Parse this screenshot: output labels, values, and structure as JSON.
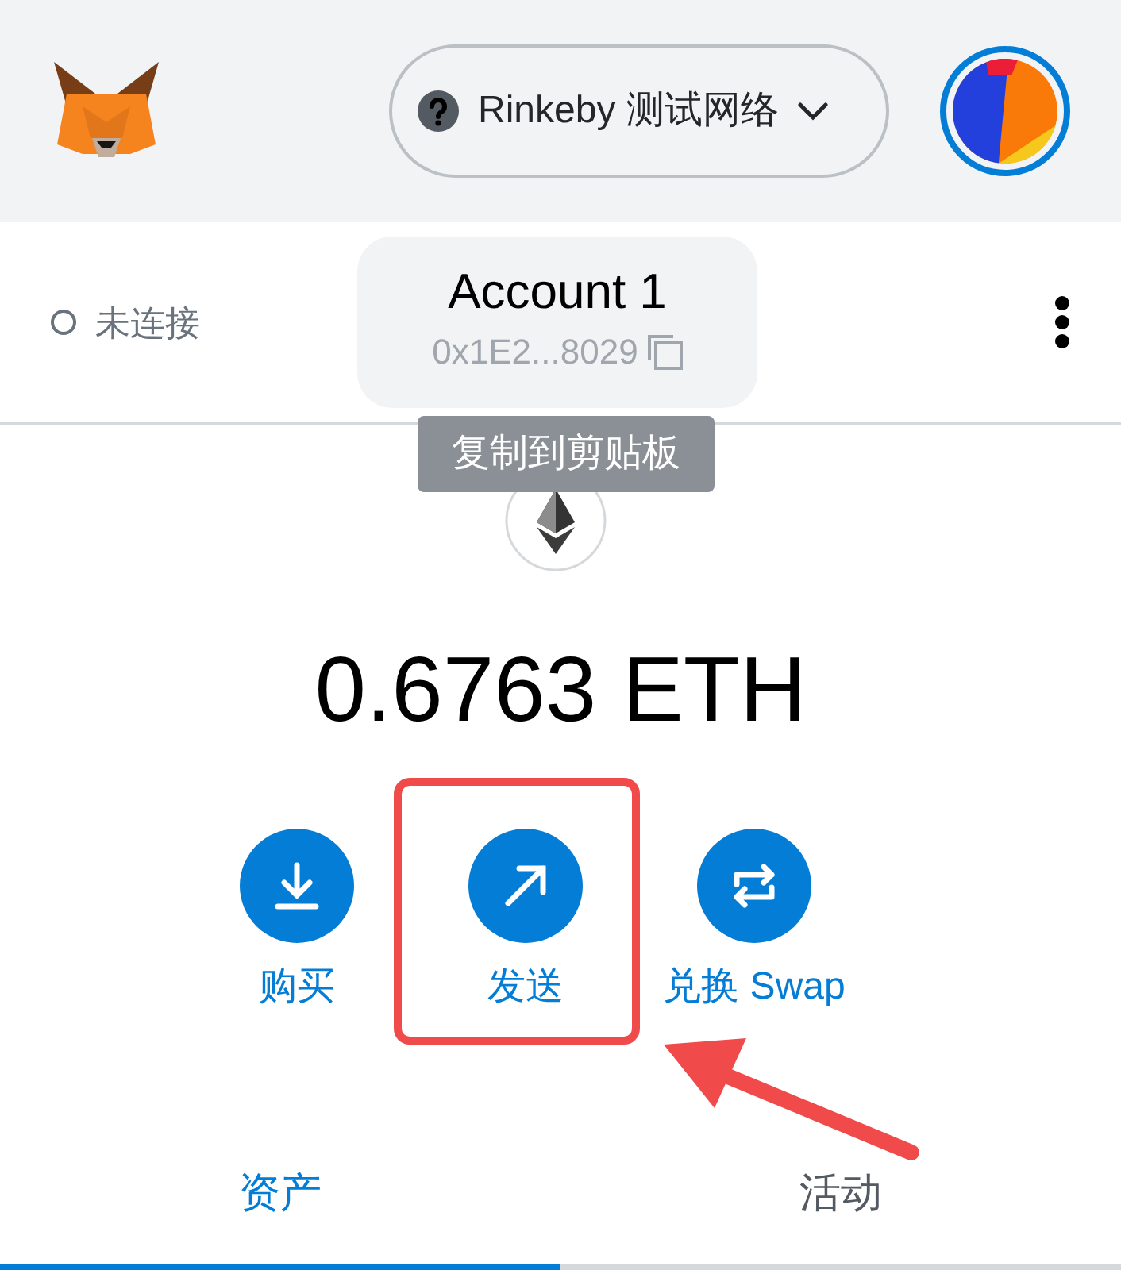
{
  "header": {
    "network": {
      "label": "Rinkeby 测试网络"
    }
  },
  "account": {
    "status": "未连接",
    "connected": false,
    "name": "Account 1",
    "address": "0x1E2...8029",
    "tooltip": "复制到剪贴板"
  },
  "balance": "0.6763 ETH",
  "actions": [
    {
      "kind": "buy",
      "label": "购买",
      "highlighted": false
    },
    {
      "kind": "send",
      "label": "发送",
      "highlighted": true
    },
    {
      "kind": "swap",
      "label": "兑换 Swap",
      "highlighted": false
    }
  ],
  "tabs": [
    {
      "label": "资产",
      "selected": true
    },
    {
      "label": "活动",
      "selected": false
    }
  ]
}
